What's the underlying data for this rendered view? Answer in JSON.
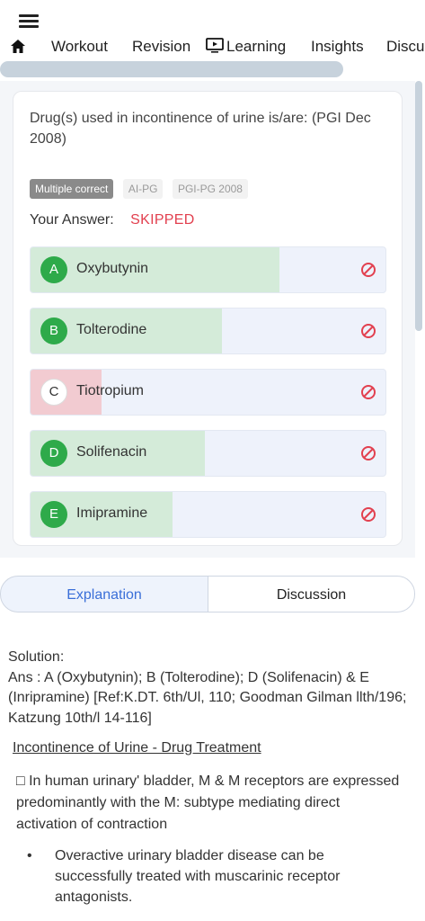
{
  "nav": {
    "tabs": [
      "Workout",
      "Revision",
      "Learning",
      "Insights",
      "Discu"
    ]
  },
  "question": {
    "text": "Drug(s) used in incontinence of urine is/are: (PGI Dec 2008)",
    "badges": [
      "Multiple correct",
      "AI-PG",
      "PGI-PG 2008"
    ],
    "answer_label": "Your Answer:",
    "answer_value": "SKIPPED",
    "options": [
      {
        "letter": "A",
        "text": "Oxybutynin",
        "percent": 70,
        "status": "correct"
      },
      {
        "letter": "B",
        "text": "Tolterodine",
        "percent": 54,
        "status": "correct"
      },
      {
        "letter": "C",
        "text": "Tiotropium",
        "percent": 20,
        "status": "incorrect"
      },
      {
        "letter": "D",
        "text": "Solifenacin",
        "percent": 49,
        "status": "correct"
      },
      {
        "letter": "E",
        "text": "Imipramine",
        "percent": 40,
        "status": "correct"
      }
    ]
  },
  "tabs": {
    "explanation": "Explanation",
    "discussion": "Discussion"
  },
  "solution": {
    "label": "Solution:",
    "answer": "Ans : A (Oxybutynin); B (Tolterodine); D (Solifenacin) & E (Inripramine) [Ref:K.DT. 6th/Ul, 110; Goodman Gilman llth/196; Katzung 10th/l 14-116]",
    "heading": "Incontinence of Urine - Drug Treatment",
    "para": "□ In human urinary' bladder, M & M receptors are expressed predominantly with the M: subtype mediating direct activation of contraction",
    "bullet": "Overactive urinary bladder disease can be successfully treated with muscarinic receptor antagonists."
  },
  "colors": {
    "correct_fill": "#d4ebd9",
    "incorrect_fill": "#f2cbd1",
    "skipped": "#e2404f",
    "accent": "#3a6fd8"
  }
}
